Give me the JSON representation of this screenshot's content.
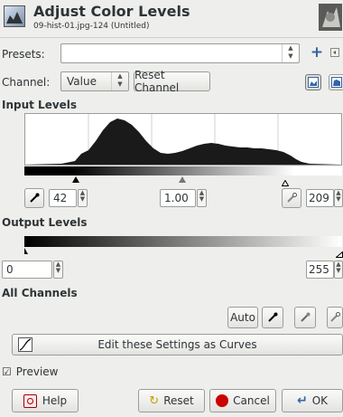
{
  "header": {
    "title": "Adjust Color Levels",
    "subtitle": "09-hist-01.jpg-124 (Untitled)"
  },
  "presets": {
    "label": "Presets:",
    "value": "",
    "add_icon": "plus-icon",
    "menu_icon": "menu-icon"
  },
  "channel": {
    "label": "Channel:",
    "value": "Value",
    "reset_label": "Reset Channel",
    "histogram_modes": [
      "linear-histogram-icon",
      "log-histogram-icon"
    ]
  },
  "input_levels": {
    "heading": "Input Levels",
    "low": "42",
    "gamma": "1.00",
    "high": "209"
  },
  "output_levels": {
    "heading": "Output Levels",
    "low": "0",
    "high": "255"
  },
  "all_channels": {
    "heading": "All Channels",
    "auto_label": "Auto",
    "pickers": [
      "black-point-picker-icon",
      "gray-point-picker-icon",
      "white-point-picker-icon"
    ],
    "curves_label": "Edit these Settings as Curves"
  },
  "preview": {
    "label": "Preview",
    "checked": true
  },
  "buttons": {
    "help": "Help",
    "reset": "Reset",
    "cancel": "Cancel",
    "ok": "OK"
  },
  "colors": {
    "background": "#eeeeec",
    "cancel_icon": "#cc0000",
    "ok_icon": "#3465a4"
  }
}
